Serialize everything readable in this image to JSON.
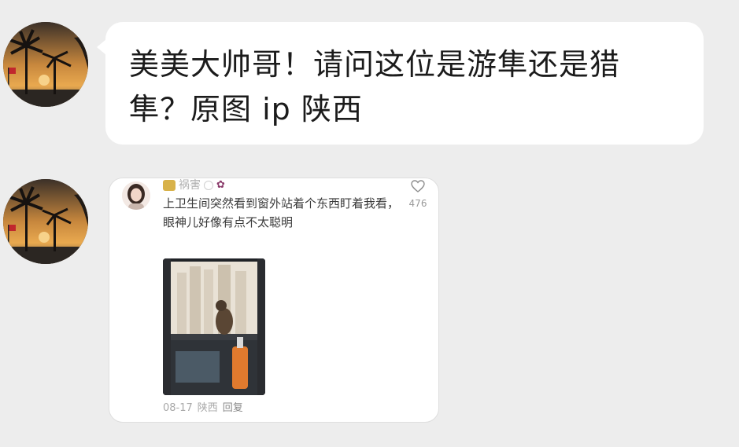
{
  "messages": [
    {
      "type": "text",
      "sender_avatar": "palm-tree-sunset-avatar",
      "text": "美美大帅哥！请问这位是游隼还是猎隼？原图 ip 陕西"
    },
    {
      "type": "image",
      "sender_avatar": "palm-tree-sunset-avatar",
      "comment": {
        "username": "祸害",
        "text": "上卫生间突然看到窗外站着个东西盯着我看，眼神儿好像有点不太聪明",
        "like_count": "476",
        "date": "08-17",
        "location": "陕西",
        "reply_label": "回复"
      }
    }
  ],
  "colors": {
    "background": "#ededed",
    "bubble": "#ffffff",
    "text": "#1b1b1b"
  }
}
